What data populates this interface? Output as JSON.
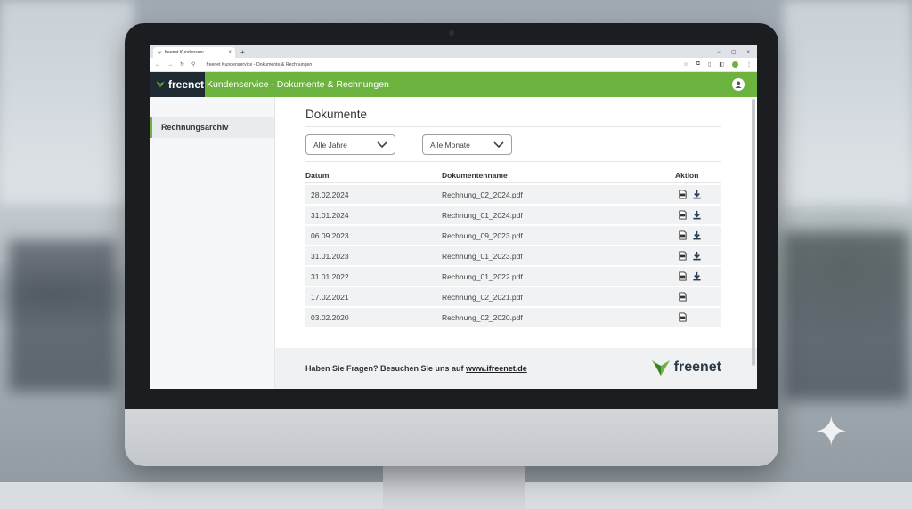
{
  "browser": {
    "tab_title": "freenet Kundenserv...",
    "tab_close": "×",
    "new_tab": "+",
    "window_controls": [
      "−",
      "▢",
      "×"
    ],
    "nav": [
      "←",
      "→",
      "↻"
    ],
    "url": "freenet Kundenservice - Dokumente & Rechnungen"
  },
  "app": {
    "brand": "freenet",
    "title": "Kundenservice - Dokumente & Rechnungen",
    "brand_color": "#6cb33f"
  },
  "sidebar": {
    "items": [
      {
        "label": "Rechnungsarchiv",
        "active": true
      }
    ]
  },
  "main": {
    "title": "Dokumente",
    "filters": {
      "year": "Alle Jahre",
      "month": "Alle Monate"
    },
    "table": {
      "headers": [
        "Datum",
        "Dokumentenname",
        "Aktion"
      ],
      "rows": [
        {
          "date": "28.02.2024",
          "name": "Rechnung_02_2024.pdf",
          "download": true
        },
        {
          "date": "31.01.2024",
          "name": "Rechnung_01_2024.pdf",
          "download": true
        },
        {
          "date": "06.09.2023",
          "name": "Rechnung_09_2023.pdf",
          "download": true
        },
        {
          "date": "31.01.2023",
          "name": "Rechnung_01_2023.pdf",
          "download": true
        },
        {
          "date": "31.01.2022",
          "name": "Rechnung_01_2022.pdf",
          "download": true
        },
        {
          "date": "17.02.2021",
          "name": "Rechnung_02_2021.pdf",
          "download": false
        },
        {
          "date": "03.02.2020",
          "name": "Rechnung_02_2020.pdf",
          "download": false
        }
      ]
    }
  },
  "footer": {
    "text": "Haben Sie Fragen? Besuchen Sie uns auf ",
    "link": "www.ifreenet.de",
    "brand": "freenet"
  }
}
